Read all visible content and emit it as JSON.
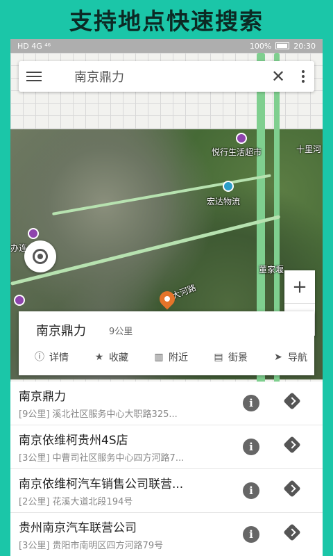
{
  "banner": {
    "title": "支持地点快速搜索"
  },
  "status_bar": {
    "left": "HD 4G ⁴⁶",
    "battery": "100%",
    "time": "20:30"
  },
  "search": {
    "query": "南京鼎力"
  },
  "map": {
    "pois": [
      "悦行生活超市",
      "宏达物流",
      "十里河",
      "董家堰",
      "大河路",
      "办连"
    ]
  },
  "zoom": {
    "in": "+",
    "out": "−"
  },
  "card": {
    "title": "南京鼎力",
    "distance": "9公里",
    "actions": [
      {
        "label": "详情",
        "icon": "info-icon"
      },
      {
        "label": "收藏",
        "icon": "star-icon"
      },
      {
        "label": "附近",
        "icon": "map-icon"
      },
      {
        "label": "街景",
        "icon": "streetview-icon"
      },
      {
        "label": "导航",
        "icon": "navigation-icon"
      }
    ]
  },
  "results": [
    {
      "name": "南京鼎力",
      "address": "[9公里]  溪北社区服务中心大职路325..."
    },
    {
      "name": "南京依维柯贵州4S店",
      "address": "[3公里]  中曹司社区服务中心四方河路7..."
    },
    {
      "name": "南京依维柯汽车销售公司联营...",
      "address": "[2公里]  花溪大道北段194号"
    },
    {
      "name": "贵州南京汽车联营公司",
      "address": "[3公里]  贵阳市南明区四方河路79号"
    }
  ],
  "colors": {
    "background": "#1bc6a8",
    "pin": "#e5742a",
    "poi": "#8e44ad"
  }
}
